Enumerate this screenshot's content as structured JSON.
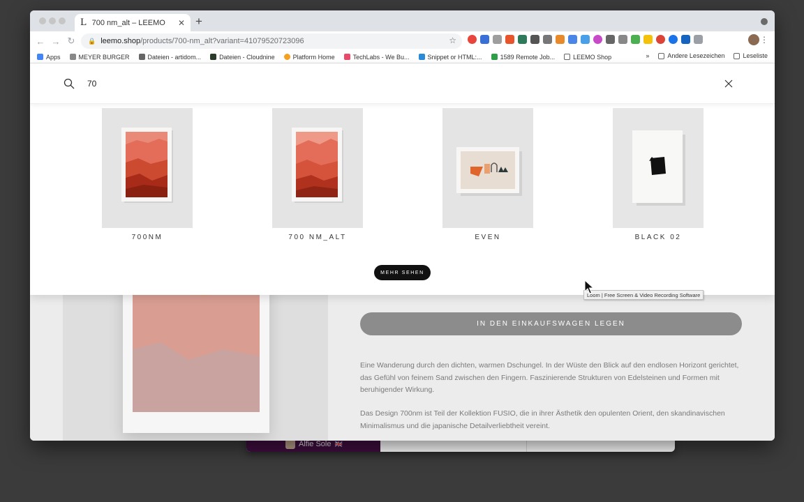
{
  "browser": {
    "tab_title": "700 nm_alt – LEEMO",
    "tab_favicon": "L",
    "url_host": "leemo.shop",
    "url_path": "/products/700-nm_alt?variant=41079520723096"
  },
  "bookmarks": {
    "items": [
      "Apps",
      "MEYER BURGER",
      "Dateien - artidom...",
      "Dateien - Cloudnine",
      "Platform Home",
      "TechLabs - We Bu...",
      "Snippet or HTML:...",
      "1589 Remote Job...",
      "LEEMO Shop"
    ],
    "overflow": "»",
    "other": "Andere Lesezeichen",
    "reading_list": "Leseliste"
  },
  "search": {
    "query": "70",
    "results": [
      {
        "name": "700NM"
      },
      {
        "name": "700 NM_ALT"
      },
      {
        "name": "EVEN"
      },
      {
        "name": "BLACK 02"
      }
    ],
    "more_label": "MEHR SEHEN"
  },
  "product": {
    "cart_label": "IN DEN EINKAUFSWAGEN LEGEN",
    "description_1": "Eine Wanderung durch den dichten, warmen Dschungel. In der Wüste den Blick auf den endlosen Horizont gerichtet, das Gefühl von feinem Sand zwischen den Fingern. Faszinierende Strukturen von Edelsteinen und Formen mit beruhigender Wirkung.",
    "description_2": "Das Design 700nm ist Teil der Kollektion FUSIO, die in ihrer Ästhetik den opulenten Orient, den skandinavischen Minimalismus und die japanische Detailverliebtheit vereint."
  },
  "tooltip": "Loom | Free Screen & Video Recording Software",
  "background_window": {
    "user_name": "Alfie Sole",
    "flag": "🇬🇧"
  },
  "colors": {
    "mountain_light": "#e98a78",
    "mountain_mid": "#cc4a30",
    "mountain_dark": "#a82a18",
    "accent_orange": "#e0652c",
    "cart_button": "#8c8c8c",
    "slack_purple": "#3f0e40"
  }
}
